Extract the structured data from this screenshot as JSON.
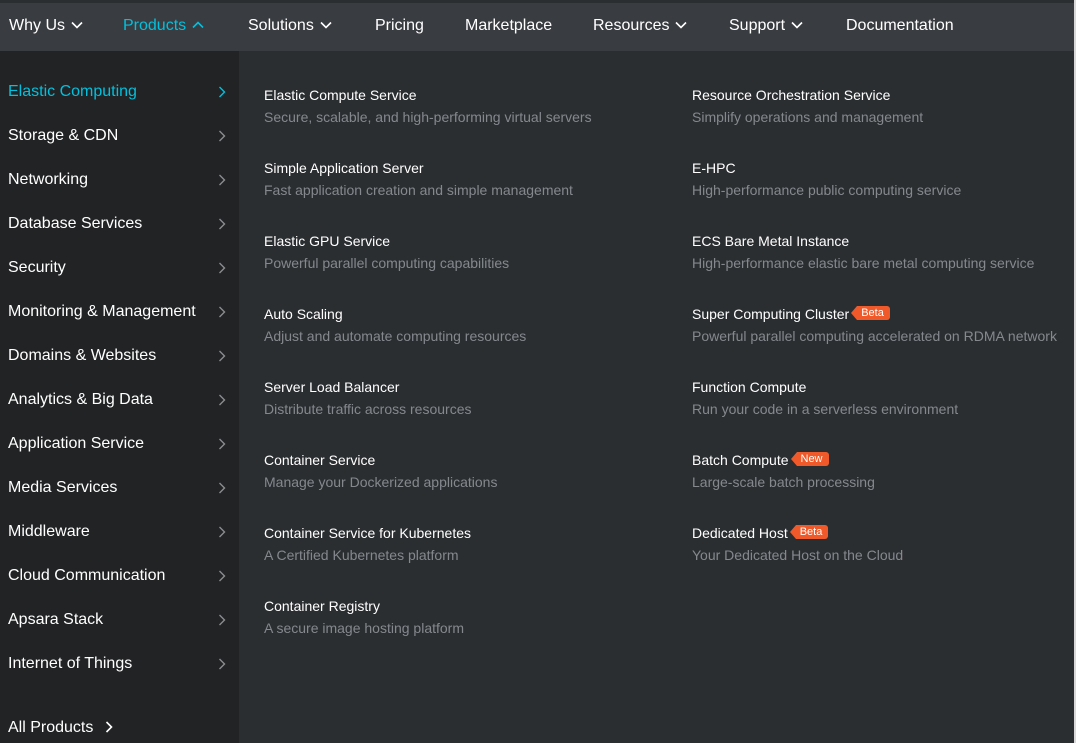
{
  "nav": {
    "items": [
      {
        "label": "Why Us",
        "has_dropdown": true,
        "active": false
      },
      {
        "label": "Products",
        "has_dropdown": true,
        "active": true
      },
      {
        "label": "Solutions",
        "has_dropdown": true,
        "active": false
      },
      {
        "label": "Pricing",
        "has_dropdown": false,
        "active": false
      },
      {
        "label": "Marketplace",
        "has_dropdown": false,
        "active": false
      },
      {
        "label": "Resources",
        "has_dropdown": true,
        "active": false
      },
      {
        "label": "Support",
        "has_dropdown": true,
        "active": false
      },
      {
        "label": "Documentation",
        "has_dropdown": false,
        "active": false
      }
    ]
  },
  "sidebar": {
    "items": [
      {
        "label": "Elastic Computing",
        "active": true
      },
      {
        "label": "Storage & CDN",
        "active": false
      },
      {
        "label": "Networking",
        "active": false
      },
      {
        "label": "Database Services",
        "active": false
      },
      {
        "label": "Security",
        "active": false
      },
      {
        "label": "Monitoring & Management",
        "active": false
      },
      {
        "label": "Domains & Websites",
        "active": false
      },
      {
        "label": "Analytics & Big Data",
        "active": false
      },
      {
        "label": "Application Service",
        "active": false
      },
      {
        "label": "Media Services",
        "active": false
      },
      {
        "label": "Middleware",
        "active": false
      },
      {
        "label": "Cloud Communication",
        "active": false
      },
      {
        "label": "Apsara Stack",
        "active": false
      },
      {
        "label": "Internet of Things",
        "active": false
      }
    ],
    "all_products_label": "All Products"
  },
  "services": {
    "left": [
      {
        "name": "Elastic Compute Service",
        "desc": "Secure, scalable, and high-performing virtual servers"
      },
      {
        "name": "Simple Application Server",
        "desc": "Fast application creation and simple management"
      },
      {
        "name": "Elastic GPU Service",
        "desc": "Powerful parallel computing capabilities"
      },
      {
        "name": "Auto Scaling",
        "desc": "Adjust and automate computing resources"
      },
      {
        "name": "Server Load Balancer",
        "desc": "Distribute traffic across resources"
      },
      {
        "name": "Container Service",
        "desc": "Manage your Dockerized applications"
      },
      {
        "name": "Container Service for Kubernetes",
        "desc": "A Certified Kubernetes platform"
      },
      {
        "name": "Container Registry",
        "desc": "A secure image hosting platform"
      }
    ],
    "right": [
      {
        "name": "Resource Orchestration Service",
        "desc": "Simplify operations and management",
        "badge": ""
      },
      {
        "name": "E-HPC",
        "desc": "High-performance public computing service",
        "badge": ""
      },
      {
        "name": "ECS Bare Metal Instance",
        "desc": "High-performance elastic bare metal computing service",
        "badge": ""
      },
      {
        "name": "Super Computing Cluster",
        "desc": "Powerful parallel computing accelerated on RDMA network",
        "badge": "Beta"
      },
      {
        "name": "Function Compute",
        "desc": "Run your code in a serverless environment",
        "badge": ""
      },
      {
        "name": "Batch Compute",
        "desc": "Large-scale batch processing",
        "badge": "New"
      },
      {
        "name": "Dedicated Host",
        "desc": "Your Dedicated Host on the Cloud",
        "badge": "Beta"
      }
    ]
  },
  "colors": {
    "accent": "#00c1de",
    "badge": "#f05a2a",
    "nav_bg": "#393c40",
    "sidebar_bg": "#212325",
    "content_bg": "#2b2e31",
    "desc_text": "#85898e"
  },
  "icons": {
    "dropdown": "chevron-down-icon",
    "dropdown_open": "chevron-up-icon",
    "side_arrow": "chevron-right-icon"
  }
}
